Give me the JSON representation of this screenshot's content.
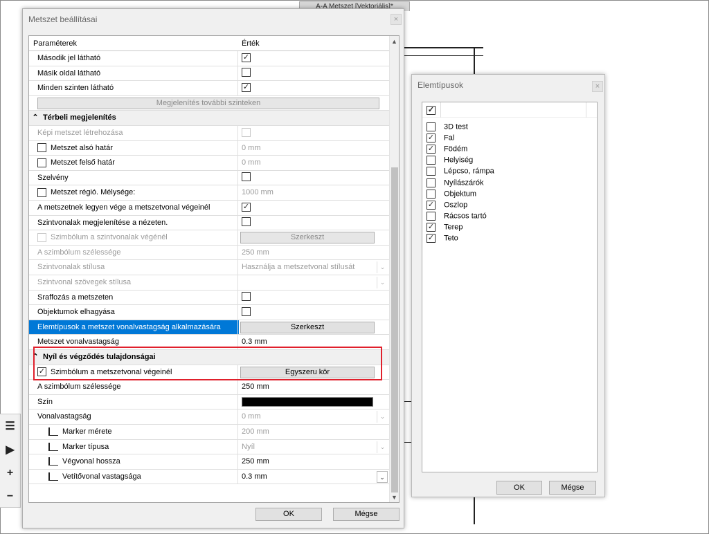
{
  "background": {
    "doc_tab": "A-A Metszet [Vektoriális]*"
  },
  "toolbar": {
    "list_icon": "☰",
    "play_icon": "▶",
    "plus": "+",
    "minus": "−"
  },
  "dialog": {
    "title": "Metszet beállításai",
    "close": "×",
    "columns": {
      "param": "Paraméterek",
      "value": "Érték"
    },
    "rows": [
      {
        "label": "Második jel látható",
        "checked": true
      },
      {
        "label": "Másik oldal látható",
        "checked": false
      },
      {
        "label": "Minden szinten látható",
        "checked": true
      },
      {
        "button": "Megjelenítés további szinteken"
      },
      {
        "section": "Térbeli megjelenítés"
      },
      {
        "label": "Képi metszet létrehozása",
        "checked": false
      },
      {
        "label": "Metszet alsó határ",
        "value": "0 mm"
      },
      {
        "label": "Metszet felső határ",
        "value": "0 mm"
      },
      {
        "label": "Szelvény",
        "checked": false
      },
      {
        "label": "Metszet régió. Mélysége:",
        "value": "1000 mm"
      },
      {
        "label": "A metszetnek legyen vége a metszetvonal végeinél",
        "checked": true
      },
      {
        "label": "Szintvonalak megjelenítése a nézeten.",
        "checked": false
      },
      {
        "label": "Szimbólum a szintvonalak végénél",
        "button": "Szerkeszt"
      },
      {
        "label": "A szimbólum szélessége",
        "value": "250 mm"
      },
      {
        "label": "Szintvonalak stílusa",
        "value": "Használja a metszetvonal stílusát"
      },
      {
        "label": "Szintvonal szövegek stílusa",
        "value": ""
      },
      {
        "label": "Sraffozás a metszeten",
        "checked": false
      },
      {
        "label": "Objektumok elhagyása",
        "checked": false
      },
      {
        "label": "Elemtípusok a metszet vonalvastagság alkalmazására",
        "button": "Szerkeszt"
      },
      {
        "label": "Metszet vonalvastagság",
        "value": "0.3 mm"
      },
      {
        "section": "Nyíl és végződés tulajdonságai"
      },
      {
        "label": "Szimbólum a metszetvonal végeinél",
        "button": "Egyszeru kör"
      },
      {
        "label": "A szimbólum szélessége",
        "value": "250 mm"
      },
      {
        "label": "Szín"
      },
      {
        "label": "Vonalvastagság",
        "value": "0 mm"
      },
      {
        "label": "Marker mérete",
        "value": "200 mm"
      },
      {
        "label": "Marker típusa",
        "value": "Nyíl"
      },
      {
        "label": "Végvonal hossza",
        "value": "250 mm"
      },
      {
        "label": "Vetítővonal vastagsága",
        "value": "0.3 mm"
      }
    ],
    "ok": "OK",
    "cancel": "Mégse",
    "check_glyph": "✓",
    "collapse_glyph": "⌃",
    "dropdown_glyph": "⌄",
    "scroll_up": "▲",
    "scroll_down": "▼",
    "color_swatch": "#000000"
  },
  "elem_dialog": {
    "title": "Elemtípusok",
    "close": "×",
    "items": [
      {
        "label": "3D test",
        "checked": false
      },
      {
        "label": "Fal",
        "checked": true
      },
      {
        "label": "Födém",
        "checked": true
      },
      {
        "label": "Helyiség",
        "checked": false
      },
      {
        "label": "Lépcso, rámpa",
        "checked": false
      },
      {
        "label": "Nyílászárók",
        "checked": false
      },
      {
        "label": "Objektum",
        "checked": false
      },
      {
        "label": "Oszlop",
        "checked": true
      },
      {
        "label": "Rácsos tartó",
        "checked": false
      },
      {
        "label": "Terep",
        "checked": true
      },
      {
        "label": "Teto",
        "checked": true
      }
    ],
    "ok": "OK",
    "cancel": "Mégse"
  },
  "colors": {
    "selection": "#0078d7",
    "highlight_box": "#e0202c"
  }
}
